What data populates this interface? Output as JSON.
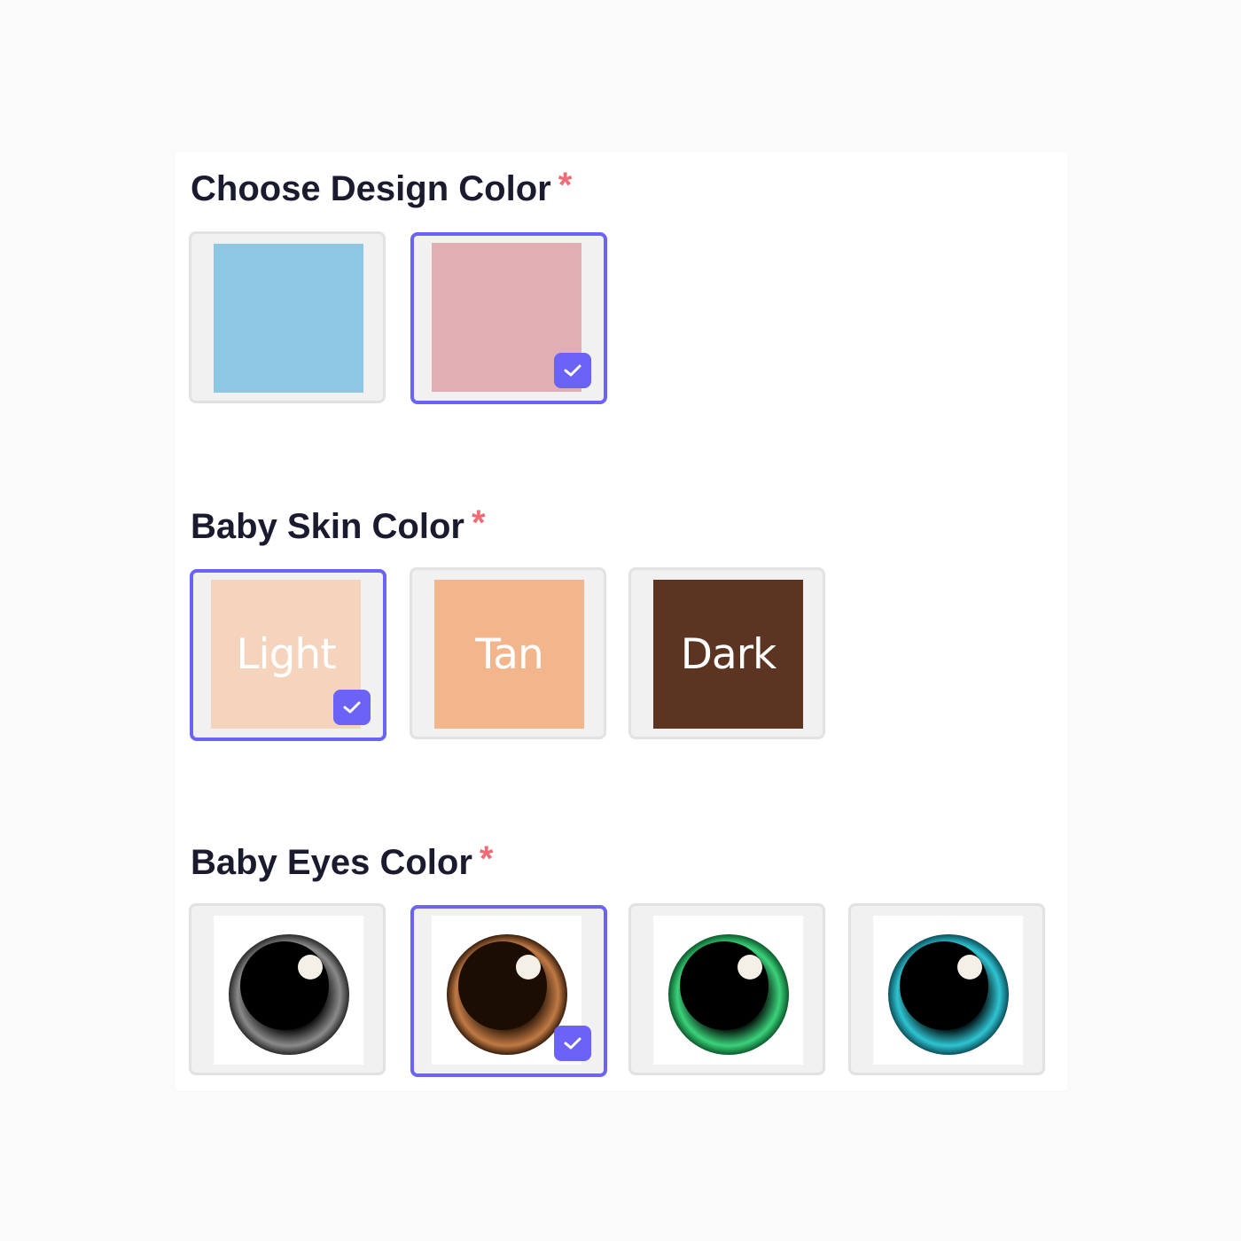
{
  "required_marker": "*",
  "accent_color": "#6a63f5",
  "sections": {
    "design_color": {
      "title": "Choose Design Color",
      "options": [
        {
          "name": "blue",
          "color": "#8ec7e4",
          "selected": false
        },
        {
          "name": "pink",
          "color": "#e1aeb4",
          "selected": true
        }
      ]
    },
    "skin_color": {
      "title": "Baby Skin Color",
      "options": [
        {
          "label": "Light",
          "color": "#f5d3bc",
          "selected": true
        },
        {
          "label": "Tan",
          "color": "#f2b58c",
          "selected": false
        },
        {
          "label": "Dark",
          "color": "#5c3422",
          "selected": false
        }
      ]
    },
    "eyes_color": {
      "title": "Baby Eyes Color",
      "options": [
        {
          "name": "gray",
          "iris_color": "#8a8a8a",
          "selected": false
        },
        {
          "name": "brown",
          "iris_color": "#c07a45",
          "selected": true
        },
        {
          "name": "green",
          "iris_color": "#3bd27a",
          "selected": false
        },
        {
          "name": "blue",
          "iris_color": "#2fc4d2",
          "selected": false
        }
      ]
    }
  }
}
